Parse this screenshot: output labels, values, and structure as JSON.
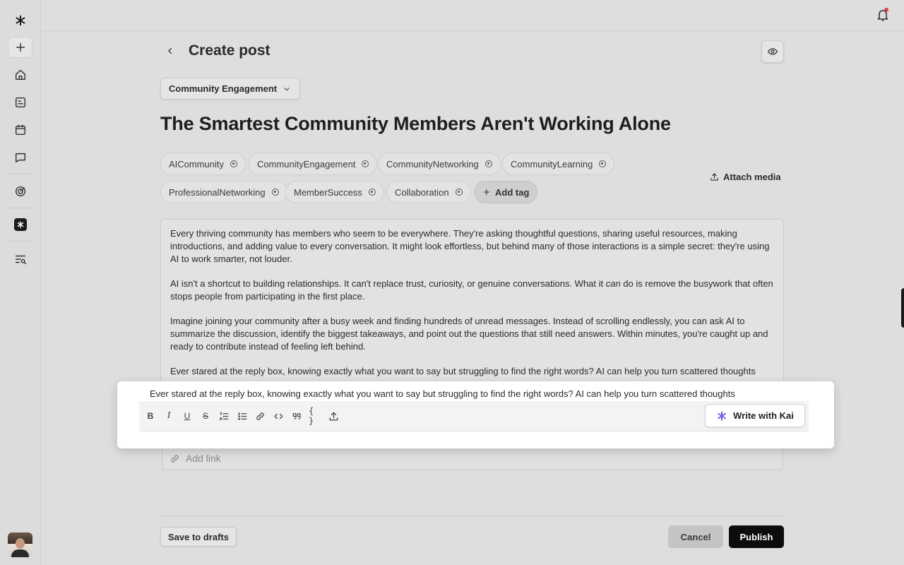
{
  "sidebar": {
    "items": [
      {
        "name": "new-item-button",
        "icon": "plus-icon"
      },
      {
        "name": "sidebar-item-home",
        "icon": "home-icon"
      },
      {
        "name": "sidebar-item-posts",
        "icon": "post-icon"
      },
      {
        "name": "sidebar-item-calendar",
        "icon": "calendar-icon"
      },
      {
        "name": "sidebar-item-messages",
        "icon": "chat-icon"
      },
      {
        "name": "sidebar-item-analytics",
        "icon": "analytics-icon"
      },
      {
        "name": "sidebar-item-kai",
        "icon": "kai-icon"
      },
      {
        "name": "sidebar-item-search",
        "icon": "list-search-icon"
      }
    ]
  },
  "header": {
    "title": "Create post"
  },
  "category": {
    "selected": "Community Engagement"
  },
  "post": {
    "title": "The Smartest Community Members Aren't Working Alone",
    "tags": [
      "AICommunity",
      "CommunityEngagement",
      "CommunityNetworking",
      "CommunityLearning",
      "ProfessionalNetworking",
      "MemberSuccess",
      "Collaboration"
    ],
    "add_tag_label": "Add tag",
    "attach_label": "Attach media",
    "body": {
      "p1": "Every thriving community has members who seem to be everywhere. They're asking thoughtful questions, sharing useful resources, making introductions, and adding value to every conversation. It might look effortless, but behind many of those interactions is a simple secret: they're using AI to work smarter, not louder.",
      "p2_a": "AI isn't a shortcut to building relationships. It can't replace trust, curiosity, or genuine conversations. What it ",
      "p2_em": "can",
      "p2_b": " do is remove the busywork that often stops people from participating in the first place.",
      "p3": "Imagine joining your community after a busy week and finding hundreds of unread messages. Instead of scrolling endlessly, you can ask AI to summarize the discussion, identify the biggest takeaways, and point out the questions that still need answers. Within minutes, you're caught up and ready to contribute instead of feeling left behind.",
      "p4": "Ever stared at the reply box, knowing exactly what you want to say but struggling to find the right words? AI can help you turn scattered thoughts"
    },
    "link_placeholder": "Add link"
  },
  "toolbar": {
    "preview_text": "Ever stared at the reply box, knowing exactly what you want to say but struggling to find the right words? AI can help you turn scattered thoughts",
    "kai_label": "Write with Kai",
    "accent": "#6b4fd8"
  },
  "footer": {
    "drafts_label": "Save to drafts",
    "cancel_label": "Cancel",
    "publish_label": "Publish"
  }
}
